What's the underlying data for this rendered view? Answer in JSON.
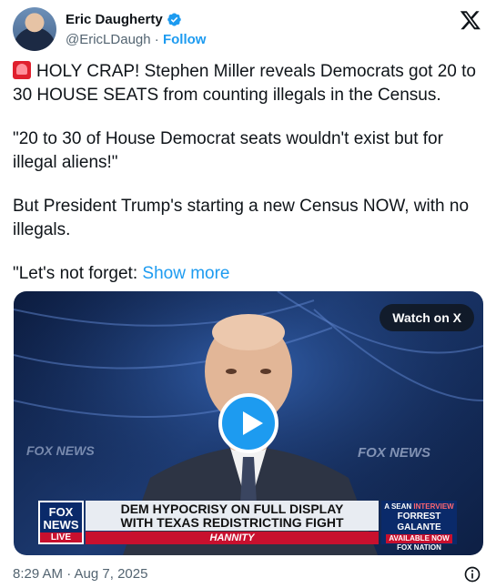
{
  "author": {
    "name": "Eric Daugherty",
    "handle": "@EricLDaugh",
    "separator": "·",
    "follow_label": "Follow"
  },
  "post": {
    "paragraphs": [
      "HOLY CRAP! Stephen Miller reveals Democrats got 20 to 30 HOUSE SEATS from counting illegals in the Census.",
      "\"20 to 30 of House Democrat seats wouldn't exist but for illegal aliens!\"",
      "But President Trump's starting a new Census NOW, with no illegals."
    ],
    "last_paragraph_prefix": "\"Let's not forget: ",
    "show_more_label": "Show more"
  },
  "media": {
    "watch_label": "Watch on X",
    "background_text_left": "FOX NEWS",
    "background_text_right": "FOX NEWS",
    "chyron": {
      "badge_top": "FOX",
      "badge_mid": "NEWS",
      "badge_live": "LIVE",
      "headline_line1": "DEM HYPOCRISY ON FULL DISPLAY",
      "headline_line2": "WITH TEXAS REDISTRICTING FIGHT",
      "show_name": "HANNITY",
      "promo_line1": "A SEAN",
      "promo_line1_accent": "INTERVIEW",
      "promo_line2": "FORREST GALANTE",
      "promo_line3": "AVAILABLE NOW",
      "promo_line4": "FOX NATION"
    }
  },
  "footer": {
    "timestamp": "8:29 AM · Aug 7, 2025"
  },
  "colors": {
    "accent": "#1d9bf0",
    "text": "#0f1419",
    "muted": "#536471"
  },
  "icons": {
    "verified": "verified-badge-icon",
    "x_logo": "x-logo-icon",
    "alarm": "rotating-light-icon",
    "play": "play-icon",
    "info": "info-icon"
  }
}
